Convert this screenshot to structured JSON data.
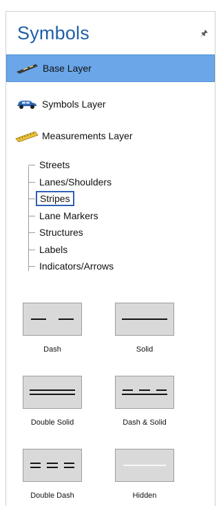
{
  "panel": {
    "title": "Symbols",
    "pin_icon": "pin-icon"
  },
  "layers": [
    {
      "label": "Base Layer",
      "icon": "road-icon",
      "selected": true
    },
    {
      "label": "Symbols Layer",
      "icon": "car-icon",
      "selected": false
    },
    {
      "label": "Measurements Layer",
      "icon": "ruler-icon",
      "selected": false
    }
  ],
  "tree": {
    "items": [
      "Streets",
      "Lanes/Shoulders",
      "Stripes",
      "Lane Markers",
      "Structures",
      "Labels",
      "Indicators/Arrows"
    ],
    "selected": "Stripes"
  },
  "stripes": {
    "items": [
      {
        "label": "Dash",
        "icon": "dash-stripe-icon"
      },
      {
        "label": "Solid",
        "icon": "solid-stripe-icon"
      },
      {
        "label": "Double Solid",
        "icon": "double-solid-stripe-icon"
      },
      {
        "label": "Dash & Solid",
        "icon": "dash-solid-stripe-icon"
      },
      {
        "label": "Double Dash",
        "icon": "double-dash-stripe-icon"
      },
      {
        "label": "Hidden",
        "icon": "hidden-stripe-icon"
      }
    ]
  },
  "colors": {
    "title": "#1f5fa8",
    "selected_layer_bg": "#6aa6e8",
    "tile_bg": "#d9d9d9"
  }
}
